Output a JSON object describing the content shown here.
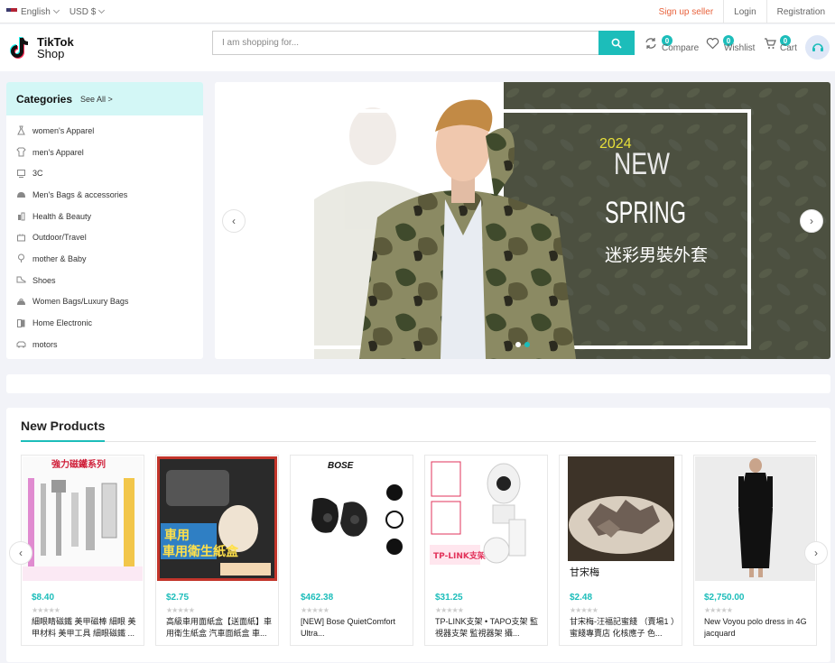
{
  "topbar": {
    "language": "English",
    "currency": "USD $",
    "sign_up_seller": "Sign up seller",
    "login": "Login",
    "registration": "Registration"
  },
  "header": {
    "logo_line1": "TikTok",
    "logo_line2": "Shop",
    "search_placeholder": "I am shopping for...",
    "compare_label": "Compare",
    "compare_count": "0",
    "wishlist_label": "Wishlist",
    "wishlist_count": "0",
    "cart_label": "Cart",
    "cart_count": "0"
  },
  "categories": {
    "title": "Categories",
    "see_all": "See All >",
    "items": [
      {
        "label": "women's Apparel",
        "icon": "dress-icon"
      },
      {
        "label": "men's Apparel",
        "icon": "shirt-icon"
      },
      {
        "label": "3C",
        "icon": "computer-icon"
      },
      {
        "label": "Men's Bags & accessories",
        "icon": "bag-icon"
      },
      {
        "label": "Health & Beauty",
        "icon": "beauty-icon"
      },
      {
        "label": "Outdoor/Travel",
        "icon": "travel-icon"
      },
      {
        "label": "mother & Baby",
        "icon": "baby-icon"
      },
      {
        "label": "Shoes",
        "icon": "shoe-icon"
      },
      {
        "label": "Women Bags/Luxury Bags",
        "icon": "handbag-icon"
      },
      {
        "label": "Home Electronic",
        "icon": "appliance-icon"
      },
      {
        "label": "motors",
        "icon": "car-icon"
      }
    ]
  },
  "banner": {
    "year": "2024",
    "word_new": "NEW",
    "word_spring": "SPRING",
    "subtitle": "迷彩男裝外套",
    "slide_count": 2,
    "active_slide": 2
  },
  "new_products": {
    "title": "New Products",
    "items": [
      {
        "price": "$8.40",
        "name": "細眼睛磁鐵 美甲磁棒 細眼 美甲材料 美甲工具 細眼磁鐵 ...",
        "image_caption": "強力磁鐵系列"
      },
      {
        "price": "$2.75",
        "name": "高級車用面紙盒【送面紙】車用衛生紙盒 汽車面紙盒 車...",
        "image_caption": "車用衛生紙盒"
      },
      {
        "price": "$462.38",
        "name": "[NEW] Bose QuietComfort Ultra...",
        "image_caption": "BOSE"
      },
      {
        "price": "$31.25",
        "name": "TP-LINK支架 • TAPO支架 監視器支架 監視器架 攝...",
        "image_caption": ""
      },
      {
        "price": "$2.48",
        "name": "甘宋梅-汪福記蜜餞 （賣場1 ）蜜餞專賣店 化核應子 色...",
        "image_caption": "甘宋梅"
      },
      {
        "price": "$2,750.00",
        "name": "New Voyou polo dress in 4G jacquard",
        "image_caption": ""
      }
    ]
  },
  "colors": {
    "accent": "#1cbdba",
    "seller_link": "#e8623c",
    "category_header": "#d3f7f6"
  }
}
